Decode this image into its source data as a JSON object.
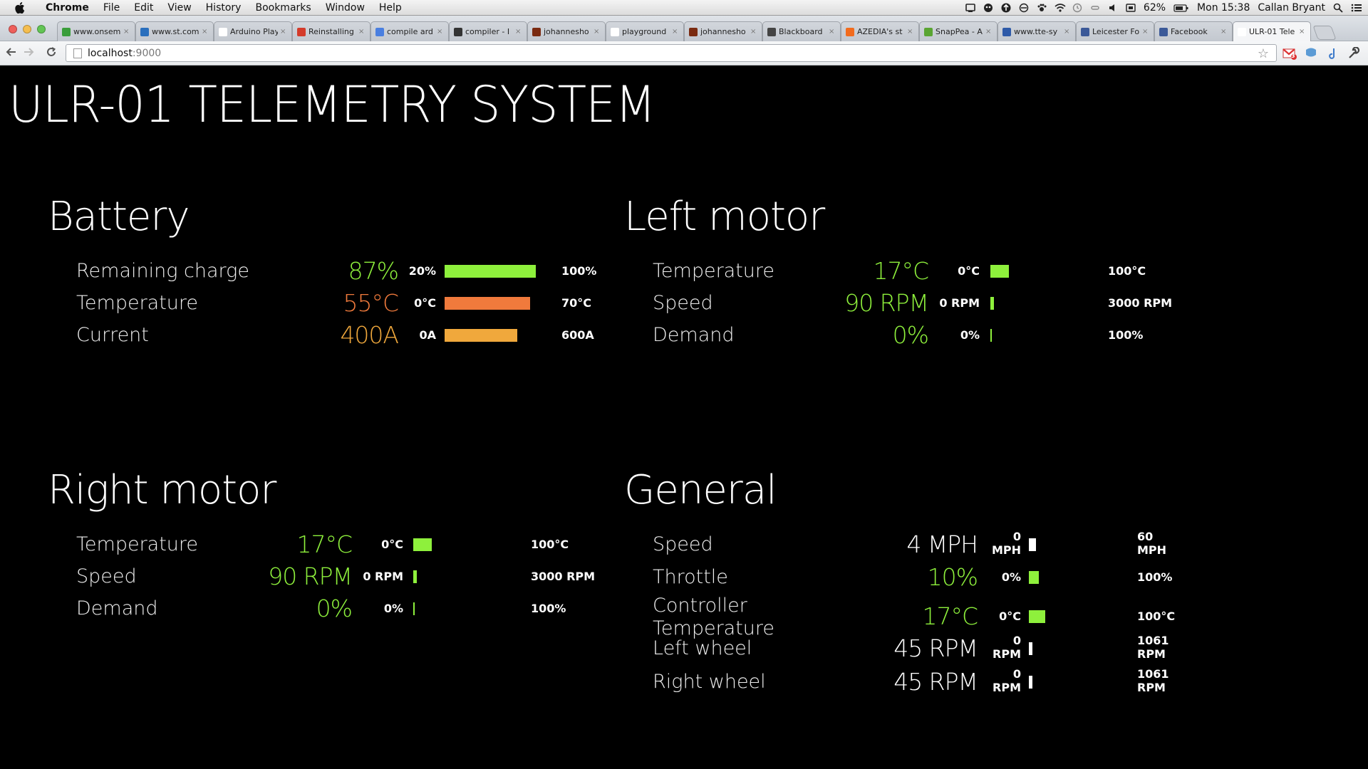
{
  "menubar": {
    "app_name": "Chrome",
    "menus": [
      "File",
      "Edit",
      "View",
      "History",
      "Bookmarks",
      "Window",
      "Help"
    ],
    "battery_percent": "62%",
    "clock": "Mon 15:38",
    "user": "Callan Bryant"
  },
  "tabs": [
    {
      "title": "www.onsem",
      "color": "#3a9d3a"
    },
    {
      "title": "www.st.com",
      "color": "#2a6fbd"
    },
    {
      "title": "Arduino Play",
      "color": "#ffffff"
    },
    {
      "title": "Reinstalling",
      "color": "#d43b2a"
    },
    {
      "title": "compile ard",
      "color": "#4a7fe0"
    },
    {
      "title": "compiler - I",
      "color": "#333333"
    },
    {
      "title": "johannesho",
      "color": "#7a2a10"
    },
    {
      "title": "playground",
      "color": "#ffffff"
    },
    {
      "title": "johannesho",
      "color": "#7a2a10"
    },
    {
      "title": "Blackboard",
      "color": "#444444"
    },
    {
      "title": "AZEDIA's st",
      "color": "#f26b1d"
    },
    {
      "title": "SnapPea - A",
      "color": "#5aa532"
    },
    {
      "title": "www.tte-sy",
      "color": "#2e5aa8"
    },
    {
      "title": "Leicester Fo",
      "color": "#3b5998"
    },
    {
      "title": "Facebook",
      "color": "#3b5998"
    },
    {
      "title": "ULR-01 Tele",
      "color": "#ffffff"
    }
  ],
  "toolbar": {
    "url_host": "localhost",
    "url_port": ":9000",
    "gmail_badge": "3"
  },
  "page": {
    "title": "ULR-01 TELEMETRY SYSTEM"
  },
  "panels": {
    "battery": {
      "title": "Battery",
      "rows": [
        {
          "label": "Remaining charge",
          "value": "87%",
          "min": "20%",
          "max": "100%",
          "level": 0.84,
          "color": "#8ef03c"
        },
        {
          "label": "Temperature",
          "value": "55°C",
          "min": "0°C",
          "max": "70°C",
          "level": 0.79,
          "color": "#f07a3c"
        },
        {
          "label": "Current",
          "value": "400A",
          "min": "0A",
          "max": "600A",
          "level": 0.67,
          "color": "#f0a83c"
        }
      ]
    },
    "left_motor": {
      "title": "Left motor",
      "rows": [
        {
          "label": "Temperature",
          "value": "17°C",
          "min": "0°C",
          "max": "100°C",
          "level": 0.17,
          "color": "#8ef03c"
        },
        {
          "label": "Speed",
          "value": "90 RPM",
          "min": "0 RPM",
          "max": "3000 RPM",
          "level": 0.03,
          "color": "#8ef03c"
        },
        {
          "label": "Demand",
          "value": "0%",
          "min": "0%",
          "max": "100%",
          "level": 0.0,
          "color": "#8ef03c"
        }
      ]
    },
    "right_motor": {
      "title": "Right motor",
      "rows": [
        {
          "label": "Temperature",
          "value": "17°C",
          "min": "0°C",
          "max": "100°C",
          "level": 0.17,
          "color": "#8ef03c"
        },
        {
          "label": "Speed",
          "value": "90 RPM",
          "min": "0 RPM",
          "max": "3000 RPM",
          "level": 0.03,
          "color": "#8ef03c"
        },
        {
          "label": "Demand",
          "value": "0%",
          "min": "0%",
          "max": "100%",
          "level": 0.0,
          "color": "#8ef03c"
        }
      ]
    },
    "general": {
      "title": "General",
      "rows": [
        {
          "label": "Speed",
          "value": "4 MPH",
          "min_top": "0",
          "min_bottom": "MPH",
          "max_top": "60",
          "max_bottom": "MPH",
          "level": 0.07,
          "color": "#ffffff"
        },
        {
          "label": "Throttle",
          "value": "10%",
          "min": "0%",
          "max": "100%",
          "level": 0.1,
          "color": "#8ef03c"
        },
        {
          "label_top": "Controller",
          "label_bottom": "Temperature",
          "value": "17°C",
          "min": "0°C",
          "max": "100°C",
          "level": 0.17,
          "color": "#8ef03c"
        },
        {
          "label": "Left wheel",
          "value": "45 RPM",
          "min_top": "0",
          "min_bottom": "RPM",
          "max_top": "1061",
          "max_bottom": "RPM",
          "level": 0.04,
          "color": "#ffffff"
        },
        {
          "label": "Right wheel",
          "value": "45 RPM",
          "min_top": "0",
          "min_bottom": "RPM",
          "max_top": "1061",
          "max_bottom": "RPM",
          "level": 0.04,
          "color": "#ffffff"
        }
      ]
    }
  }
}
